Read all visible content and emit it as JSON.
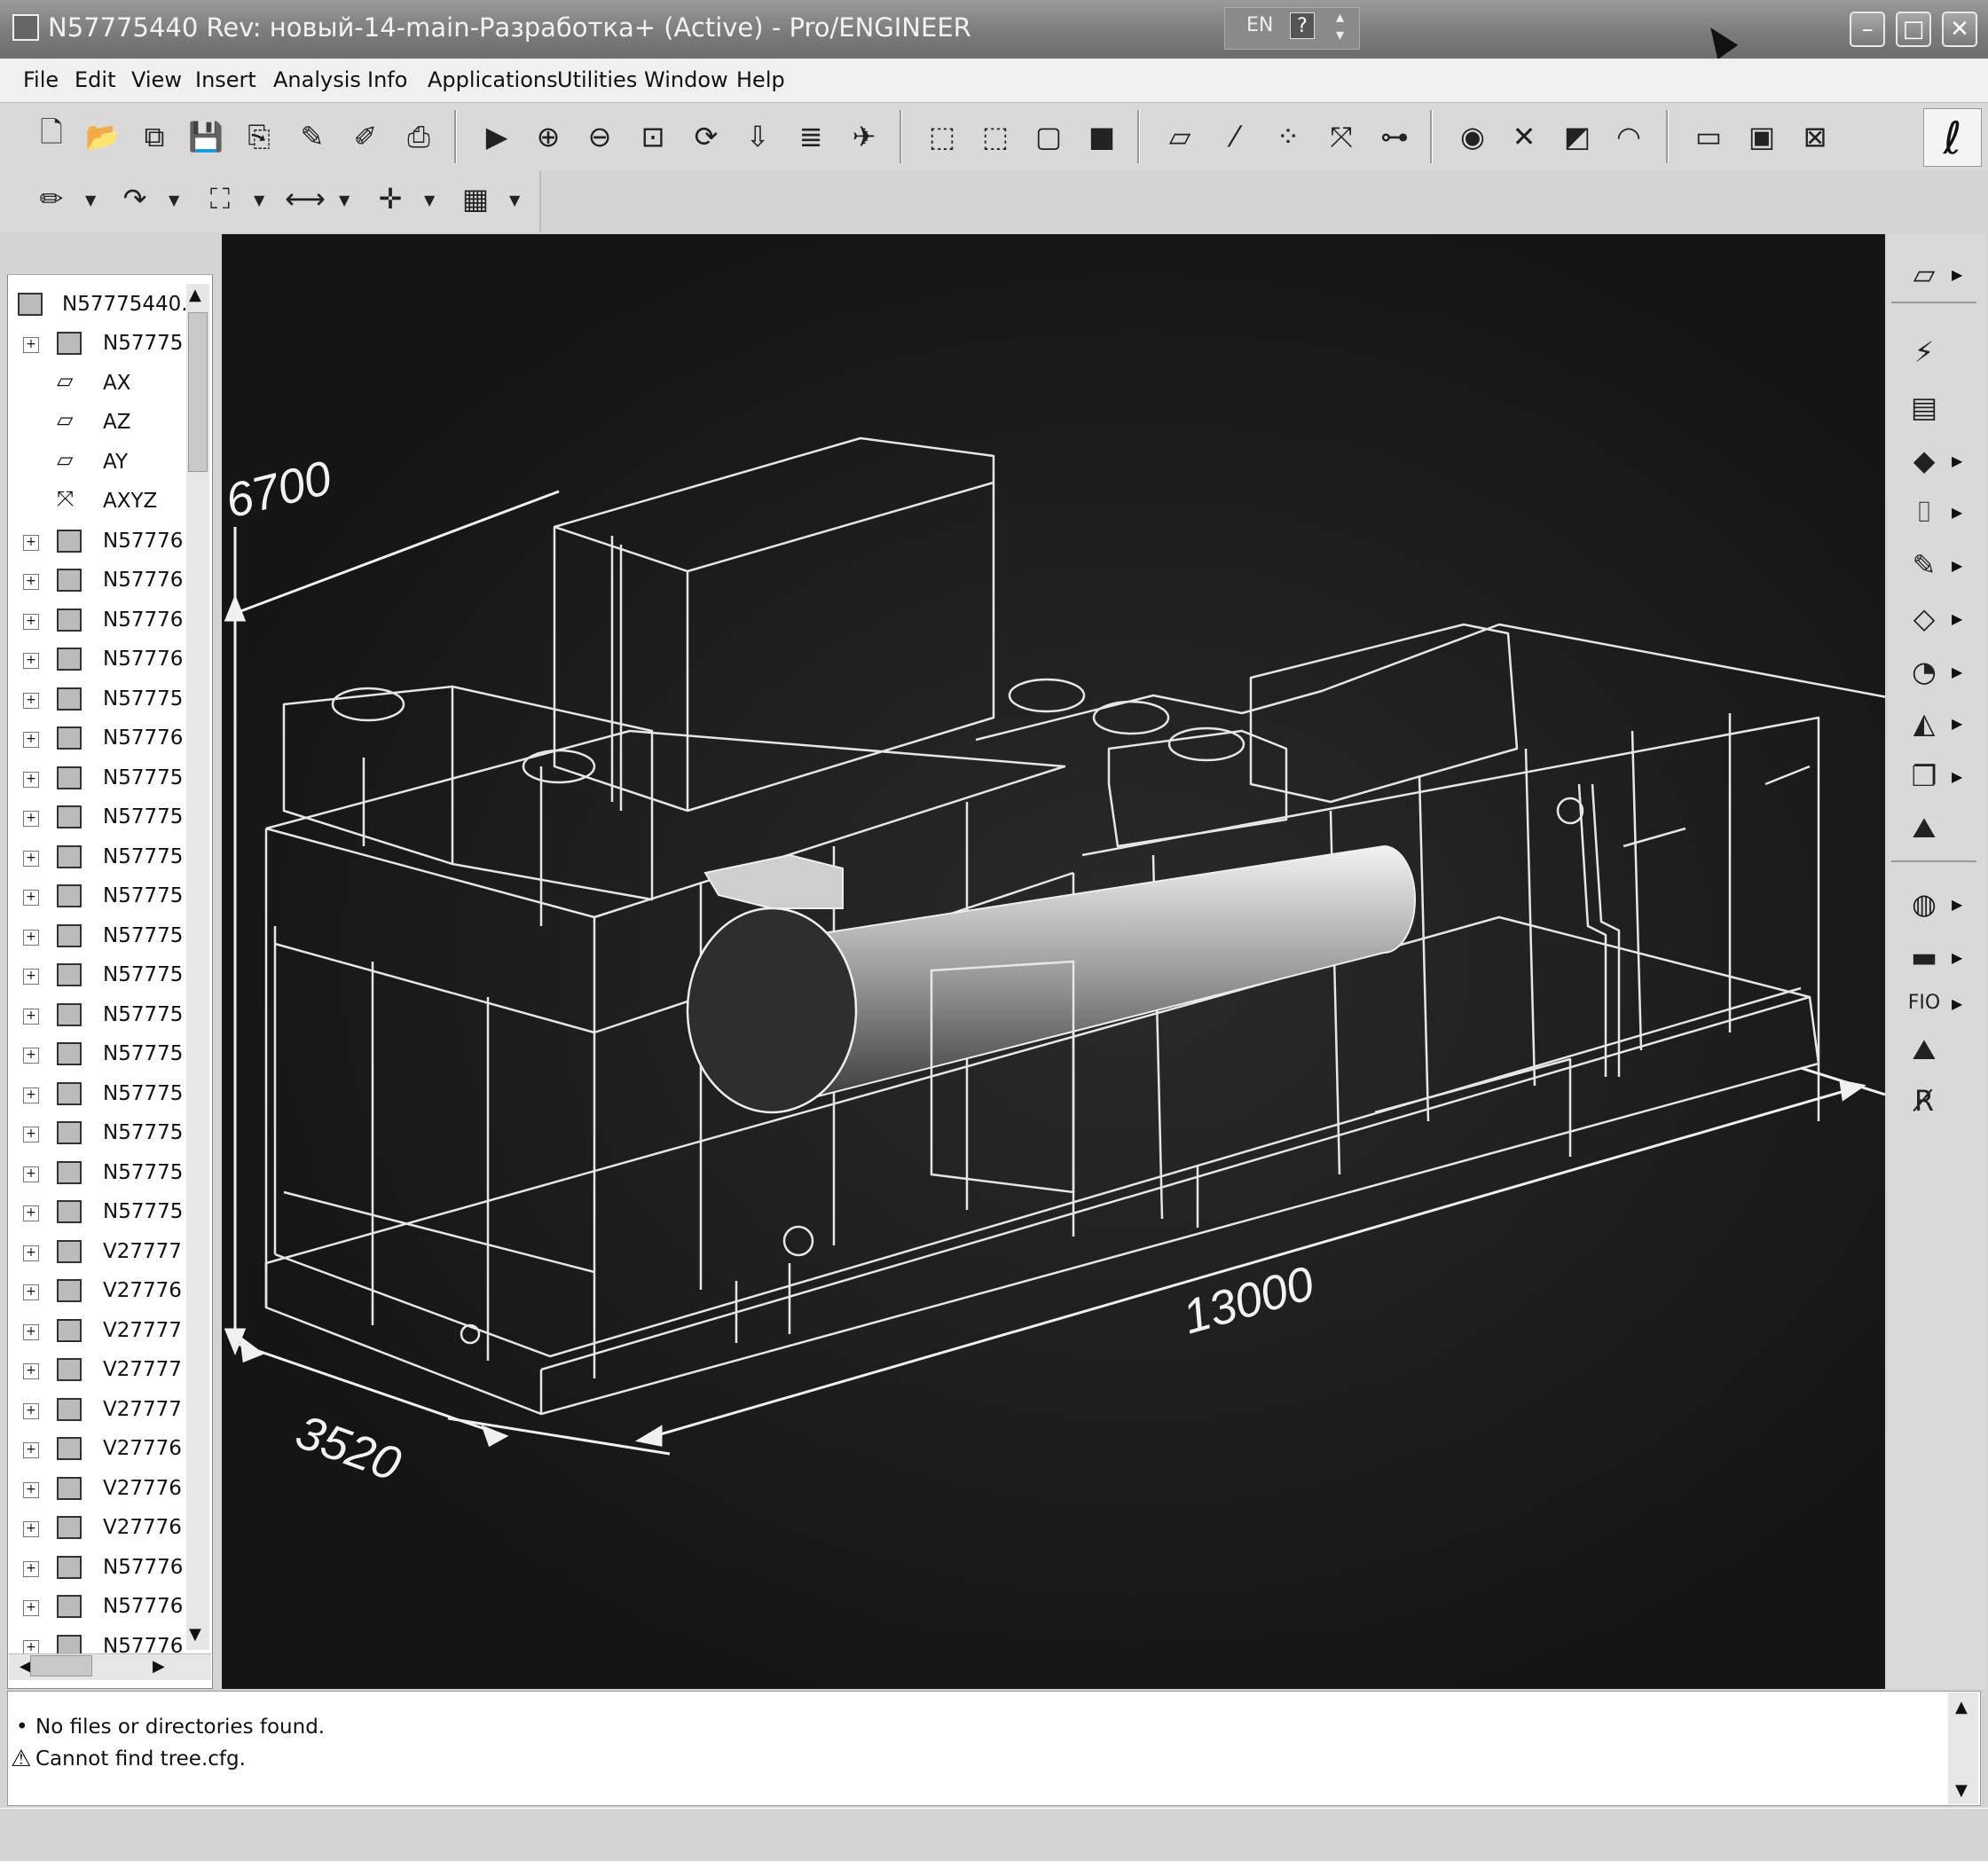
{
  "window": {
    "title": "N57775440 Rev: новый-14-main-Разработка+ (Active) - Pro/ENGINEER",
    "lang": "EN",
    "help_glyph": "?",
    "minimize": "–",
    "maximize": "□",
    "close": "✕"
  },
  "menu": [
    "File",
    "Edit",
    "View",
    "Insert",
    "Analysis",
    "Info",
    "Applications",
    "Utilities",
    "Window",
    "Help"
  ],
  "toolbar1": [
    {
      "icon": "new-icon",
      "glyph": "🗋"
    },
    {
      "icon": "open-icon",
      "glyph": "📂"
    },
    {
      "icon": "open-session-icon",
      "glyph": "⧉"
    },
    {
      "icon": "save-icon",
      "glyph": "💾"
    },
    {
      "icon": "save-copy-icon",
      "glyph": "⎘"
    },
    {
      "icon": "rename-icon",
      "glyph": "✎"
    },
    {
      "icon": "erase-icon",
      "glyph": "✐"
    },
    {
      "icon": "print-icon",
      "glyph": "⎙"
    },
    {
      "icon": "repaint-icon",
      "glyph": "▶"
    },
    {
      "icon": "zoom-in-icon",
      "glyph": "⊕"
    },
    {
      "icon": "zoom-out-icon",
      "glyph": "⊖"
    },
    {
      "icon": "refit-icon",
      "glyph": "⊡"
    },
    {
      "icon": "orient-icon",
      "glyph": "⟳"
    },
    {
      "icon": "saved-views-icon",
      "glyph": "⇩"
    },
    {
      "icon": "layers-icon",
      "glyph": "≣"
    },
    {
      "icon": "spin-center-icon",
      "glyph": "✈"
    },
    {
      "icon": "wireframe-icon",
      "glyph": "⬚"
    },
    {
      "icon": "hidden-line-icon",
      "glyph": "⬚"
    },
    {
      "icon": "no-hidden-icon",
      "glyph": "▢"
    },
    {
      "icon": "shading-icon",
      "glyph": "■"
    },
    {
      "icon": "datum-planes-icon",
      "glyph": "▱"
    },
    {
      "icon": "datum-axes-icon",
      "glyph": "⁄"
    },
    {
      "icon": "datum-points-icon",
      "glyph": "⁘"
    },
    {
      "icon": "csys-icon",
      "glyph": "⤧"
    },
    {
      "icon": "annotations-icon",
      "glyph": "⊶"
    },
    {
      "icon": "web-icon",
      "glyph": "◉"
    },
    {
      "icon": "smart-select-icon",
      "glyph": "✕"
    },
    {
      "icon": "select-icon",
      "glyph": "◩"
    },
    {
      "icon": "gauge-icon",
      "glyph": "◠"
    },
    {
      "icon": "window-icon",
      "glyph": "▭"
    },
    {
      "icon": "activate-icon",
      "glyph": "▣"
    },
    {
      "icon": "close-window-icon",
      "glyph": "⊠"
    }
  ],
  "toolbar2": [
    {
      "icon": "sketch-icon",
      "glyph": "✏"
    },
    {
      "icon": "redo-icon",
      "glyph": "↷"
    },
    {
      "icon": "tree-icon",
      "glyph": "⛶"
    },
    {
      "icon": "dimension-icon",
      "glyph": "⟷"
    },
    {
      "icon": "datum-point-icon",
      "glyph": "✛"
    },
    {
      "icon": "family-table-icon",
      "glyph": "▦"
    }
  ],
  "tree": {
    "root": "N57775440...",
    "items": [
      {
        "label": "N57775",
        "type": "asm",
        "expand": "+"
      },
      {
        "label": "AX",
        "type": "datum",
        "expand": ""
      },
      {
        "label": "AZ",
        "type": "datum",
        "expand": ""
      },
      {
        "label": "AY",
        "type": "datum",
        "expand": ""
      },
      {
        "label": "AXYZ",
        "type": "csys",
        "expand": ""
      },
      {
        "label": "N57776",
        "type": "part",
        "expand": "+"
      },
      {
        "label": "N57776",
        "type": "part",
        "expand": "+"
      },
      {
        "label": "N57776",
        "type": "part",
        "expand": "+"
      },
      {
        "label": "N57776",
        "type": "part",
        "expand": "+"
      },
      {
        "label": "N57775",
        "type": "part",
        "expand": "+"
      },
      {
        "label": "N57776",
        "type": "part",
        "expand": "+"
      },
      {
        "label": "N57775",
        "type": "part",
        "expand": "+"
      },
      {
        "label": "N57775",
        "type": "part",
        "expand": "+"
      },
      {
        "label": "N57775",
        "type": "part",
        "expand": "+"
      },
      {
        "label": "N57775",
        "type": "part",
        "expand": "+"
      },
      {
        "label": "N57775",
        "type": "part",
        "expand": "+"
      },
      {
        "label": "N57775",
        "type": "part",
        "expand": "+"
      },
      {
        "label": "N57775",
        "type": "part",
        "expand": "+"
      },
      {
        "label": "N57775",
        "type": "part",
        "expand": "+"
      },
      {
        "label": "N57775",
        "type": "part",
        "expand": "+"
      },
      {
        "label": "N57775",
        "type": "part",
        "expand": "+"
      },
      {
        "label": "N57775",
        "type": "part",
        "expand": "+"
      },
      {
        "label": "N57775",
        "type": "part",
        "expand": "+"
      },
      {
        "label": "V27777",
        "type": "part",
        "expand": "+"
      },
      {
        "label": "V27776",
        "type": "part",
        "expand": "+"
      },
      {
        "label": "V27777",
        "type": "part",
        "expand": "+"
      },
      {
        "label": "V27777",
        "type": "part",
        "expand": "+"
      },
      {
        "label": "V27777",
        "type": "part",
        "expand": "+"
      },
      {
        "label": "V27776",
        "type": "part",
        "expand": "+"
      },
      {
        "label": "V27776",
        "type": "part",
        "expand": "+"
      },
      {
        "label": "V27776",
        "type": "part",
        "expand": "+"
      },
      {
        "label": "N57776",
        "type": "part",
        "expand": "+"
      },
      {
        "label": "N57776",
        "type": "part",
        "expand": "+"
      },
      {
        "label": "N57776",
        "type": "part",
        "expand": "+"
      }
    ]
  },
  "dimensions": {
    "height": "6700",
    "width": "3520",
    "length": "13000"
  },
  "right_toolbar": [
    {
      "icon": "datum-plane-icon",
      "glyph": "▱",
      "arrow": true
    },
    {
      "icon": "feature-icon",
      "glyph": "⚡",
      "arrow": false
    },
    {
      "icon": "rev-save-icon",
      "glyph": "▤",
      "arrow": false
    },
    {
      "icon": "extrude-icon",
      "glyph": "◆",
      "arrow": true
    },
    {
      "icon": "bracket-icon",
      "glyph": "⌷",
      "arrow": true
    },
    {
      "icon": "pencil-icon",
      "glyph": "✎",
      "arrow": true
    },
    {
      "icon": "shell-icon",
      "glyph": "◇",
      "arrow": true
    },
    {
      "icon": "round-icon",
      "glyph": "◔",
      "arrow": true
    },
    {
      "icon": "rib-icon",
      "glyph": "◭",
      "arrow": true
    },
    {
      "icon": "copy-icon",
      "glyph": "❐",
      "arrow": true
    },
    {
      "icon": "assembly-icon",
      "glyph": "⛰",
      "arrow": false
    },
    {
      "icon": "analysis-icon",
      "glyph": "◍",
      "arrow": true
    },
    {
      "icon": "display-icon",
      "glyph": "▬",
      "arrow": true
    },
    {
      "icon": "fio-icon",
      "glyph": "FIO",
      "arrow": true
    },
    {
      "icon": "asm-icon",
      "glyph": "⛰",
      "arrow": false
    },
    {
      "icon": "regen-icon",
      "glyph": "R̸",
      "arrow": false
    }
  ],
  "messages": [
    {
      "icon": "bullet-icon",
      "glyph": "•",
      "text": "No files or directories found."
    },
    {
      "icon": "warning-icon",
      "glyph": "⚠",
      "text": "Cannot find tree.cfg."
    }
  ],
  "colors": {
    "viewport": "#1c1c1c",
    "wire": "#e6e6e6",
    "panel": "#d4d4d4"
  }
}
